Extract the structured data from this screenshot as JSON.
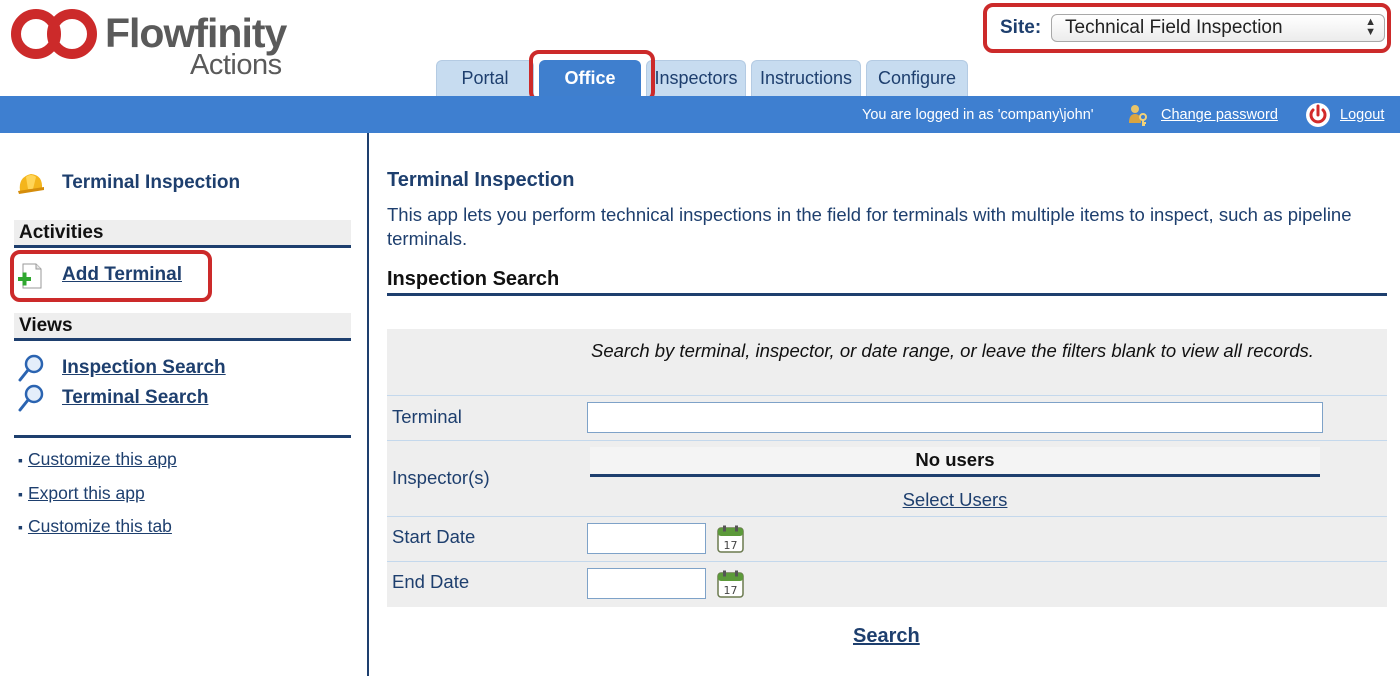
{
  "brand": {
    "name": "Flowfinity",
    "sub": "Actions",
    "colors": {
      "red": "#cc2a2a",
      "navy": "#1e3f6e",
      "blue": "#3e7fd0",
      "tab": "#c7dcf0"
    }
  },
  "site": {
    "label": "Site:",
    "selected": "Technical Field Inspection",
    "arrow_up": "▲",
    "arrow_down": "▼"
  },
  "tabs": [
    {
      "label": "Portal",
      "active": false
    },
    {
      "label": "Office",
      "active": true
    },
    {
      "label": "Inspectors",
      "active": false
    },
    {
      "label": "Instructions",
      "active": false
    },
    {
      "label": "Configure",
      "active": false
    }
  ],
  "topbar": {
    "logged_in": "You are logged in as 'company\\john'",
    "change_password": "Change password",
    "logout": "Logout",
    "key_icon": "key-person-icon",
    "power_icon": "power-icon"
  },
  "sidebar": {
    "app_title": "Terminal Inspection",
    "app_icon": "hardhat-icon",
    "activities_heading": "Activities",
    "activities": [
      {
        "label": "Add Terminal",
        "icon": "add-document-icon"
      }
    ],
    "views_heading": "Views",
    "views": [
      {
        "label": "Inspection Search",
        "icon": "magnifier-icon"
      },
      {
        "label": "Terminal Search",
        "icon": "magnifier-icon"
      }
    ],
    "bullet": "▪",
    "links": [
      "Customize this app",
      "Export this app",
      "Customize this tab"
    ]
  },
  "main": {
    "title": "Terminal Inspection",
    "description": "This app lets you perform technical inspections in the field for terminals with multiple items to inspect, such as pipeline terminals.",
    "section_title": "Inspection Search",
    "hint": "Search by terminal, inspector, or date range, or leave the filters blank to view all records.",
    "fields": {
      "terminal_label": "Terminal",
      "terminal_value": "",
      "inspectors_label": "Inspector(s)",
      "no_users": "No users",
      "select_users": "Select Users",
      "start_date_label": "Start Date",
      "start_date_value": "",
      "end_date_label": "End Date",
      "end_date_value": "",
      "calendar_day": "17"
    },
    "search_button": "Search"
  }
}
